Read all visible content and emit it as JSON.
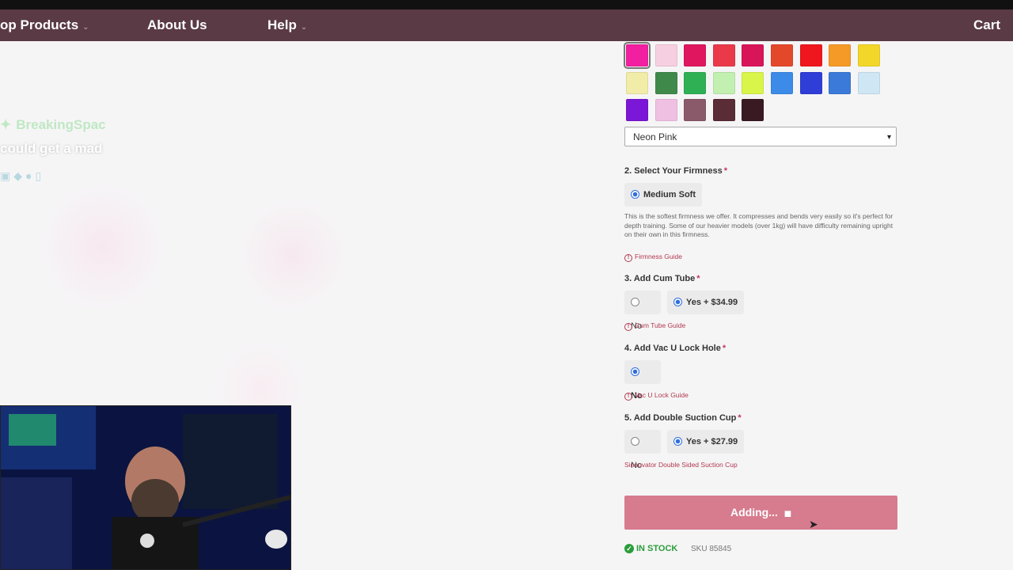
{
  "nav": {
    "items": [
      {
        "label": "op Products",
        "has_dropdown": true
      },
      {
        "label": "About Us",
        "has_dropdown": false
      },
      {
        "label": "Help",
        "has_dropdown": true
      },
      {
        "label": "Cart",
        "has_dropdown": false
      }
    ]
  },
  "stream_overlay": {
    "follower_line": "BreakingSpac",
    "message_line": "could get a mad"
  },
  "color_select": {
    "swatches": [
      {
        "color": "#f21fa0",
        "selected": true
      },
      {
        "color": "#f6cfe0"
      },
      {
        "color": "#e0175f"
      },
      {
        "color": "#ea3a4a"
      },
      {
        "color": "#d9155a"
      },
      {
        "color": "#e4482a"
      },
      {
        "color": "#f0161d"
      },
      {
        "color": "#f59a26"
      },
      {
        "color": "#f2d62a"
      },
      {
        "color": "#f1eda8"
      },
      {
        "color": "#3f8a4b"
      },
      {
        "color": "#2fb055"
      },
      {
        "color": "#c2f0b0"
      },
      {
        "color": "#d9f54a"
      },
      {
        "color": "#3d8be8"
      },
      {
        "color": "#2f3ed6"
      },
      {
        "color": "#3b7ad8"
      },
      {
        "color": "#cfe6f4"
      },
      {
        "color": "#7b17d6"
      },
      {
        "color": "#efc0e2"
      },
      {
        "color": "#8a5a6a"
      },
      {
        "color": "#5a2c36"
      },
      {
        "color": "#3a1a22"
      }
    ],
    "selected_value": "Neon Pink"
  },
  "firmness": {
    "label": "2. Select Your Firmness",
    "required_mark": "*",
    "option": "Medium Soft",
    "description": "This is the softest firmness we offer. It compresses and bends very easily so it's perfect for depth training. Some of our heavier models (over 1kg) will have difficulty remaining upright on their own in this firmness.",
    "guide": "Firmness Guide"
  },
  "cum_tube": {
    "label": "3. Add Cum Tube",
    "required_mark": "*",
    "no": "No",
    "yes": "Yes + $34.99",
    "guide": "Cum Tube Guide"
  },
  "vac_u_lock": {
    "label": "4. Add Vac U Lock Hole",
    "required_mark": "*",
    "no": "No",
    "guide": "Vac U Lock Guide"
  },
  "suction_cup": {
    "label": "5. Add Double Suction Cup",
    "required_mark": "*",
    "no": "No",
    "yes": "Yes + $27.99",
    "link": "Sinnovator Double Sided Suction Cup"
  },
  "add_button": {
    "label": "Adding...",
    "icon": "lock-icon"
  },
  "stock": {
    "status": "IN STOCK",
    "sku": "SKU 85845"
  }
}
